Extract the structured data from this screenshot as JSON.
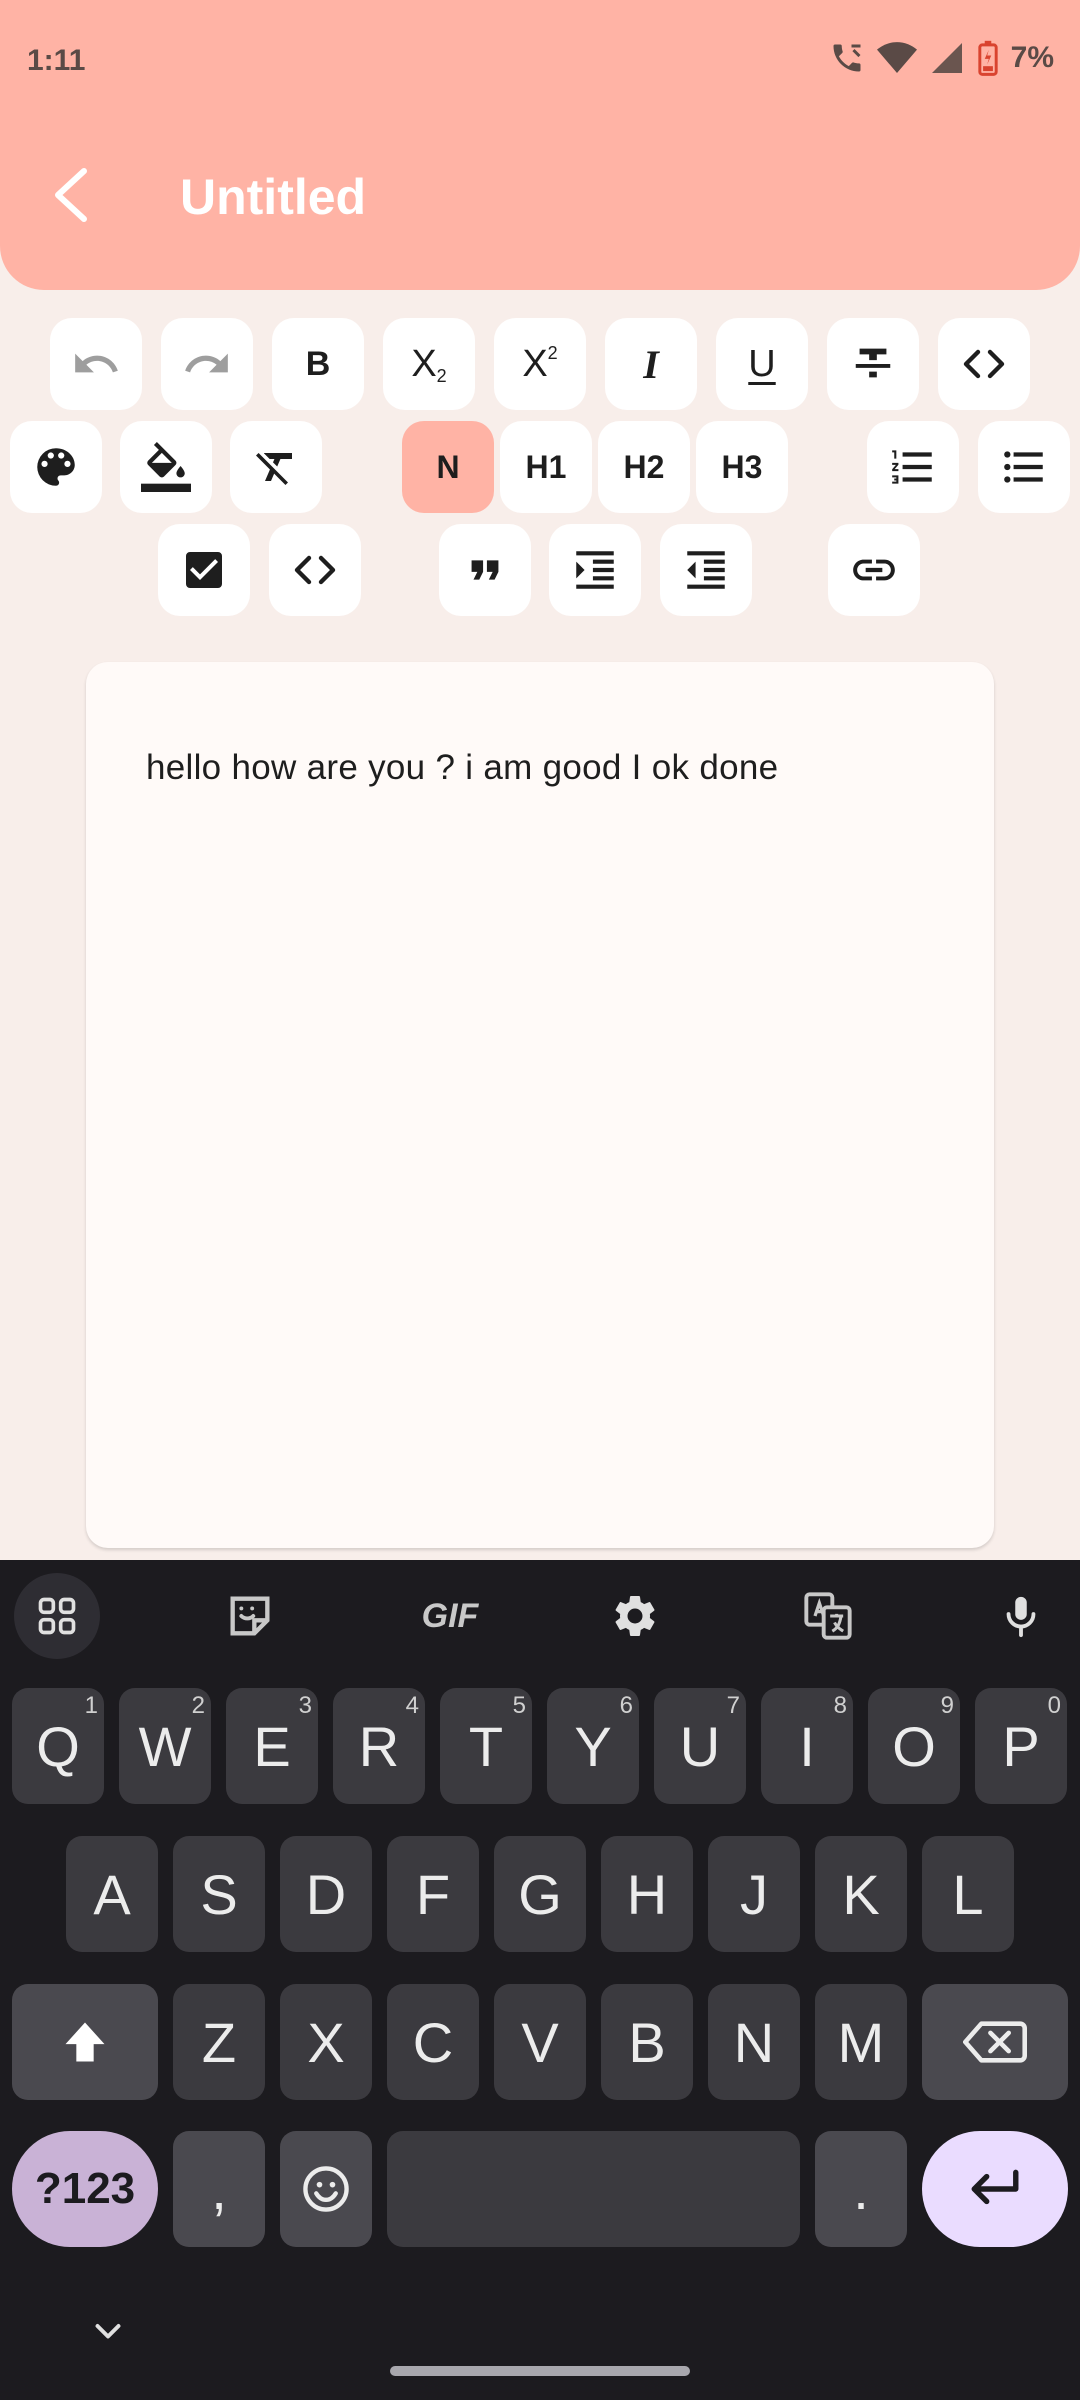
{
  "status_bar": {
    "time": "1:11",
    "battery": "7%"
  },
  "header": {
    "title": "Untitled"
  },
  "toolbar": {
    "bold": "B",
    "subscript_base": "X",
    "subscript_sup": "2",
    "superscript_base": "X",
    "superscript_sup": "2",
    "italic": "I",
    "underline": "U",
    "normal": "N",
    "h1": "H1",
    "h2": "H2",
    "h3": "H3"
  },
  "editor": {
    "content": "hello how are you ? i am good I ok done"
  },
  "keyboard": {
    "toolbar": {
      "gif": "GIF"
    },
    "row1": [
      {
        "label": "Q",
        "hint": "1"
      },
      {
        "label": "W",
        "hint": "2"
      },
      {
        "label": "E",
        "hint": "3"
      },
      {
        "label": "R",
        "hint": "4"
      },
      {
        "label": "T",
        "hint": "5"
      },
      {
        "label": "Y",
        "hint": "6"
      },
      {
        "label": "U",
        "hint": "7"
      },
      {
        "label": "I",
        "hint": "8"
      },
      {
        "label": "O",
        "hint": "9"
      },
      {
        "label": "P",
        "hint": "0"
      }
    ],
    "row2": [
      "A",
      "S",
      "D",
      "F",
      "G",
      "H",
      "J",
      "K",
      "L"
    ],
    "row3": [
      "Z",
      "X",
      "C",
      "V",
      "B",
      "N",
      "M"
    ],
    "symbols": "?123",
    "comma": ",",
    "period": "."
  }
}
